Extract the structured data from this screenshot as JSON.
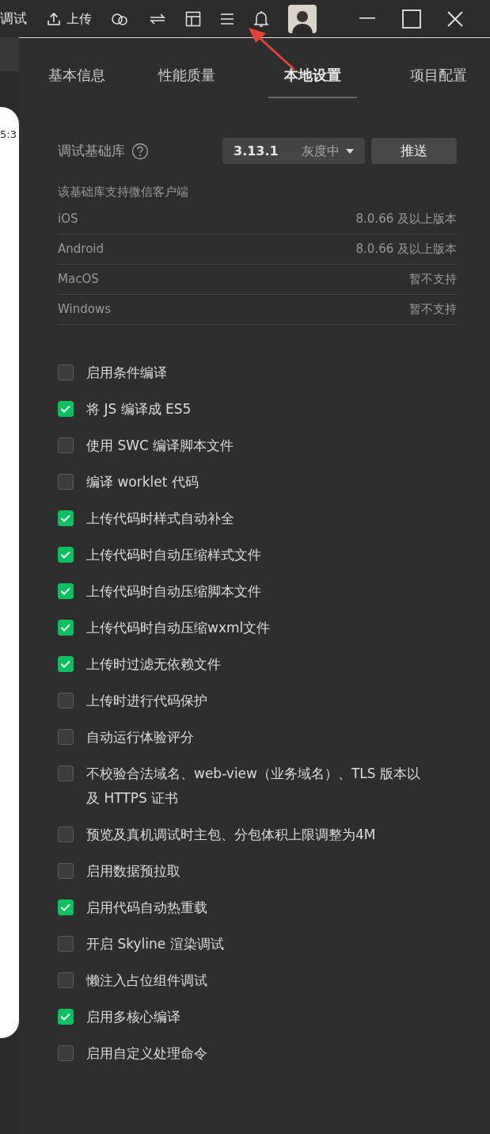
{
  "toolbar": {
    "debug_label": "调试",
    "upload_label": "上传"
  },
  "simulator": {
    "time": "5:3"
  },
  "tabs": [
    {
      "label": "基本信息",
      "selected": false
    },
    {
      "label": "性能质量",
      "selected": false
    },
    {
      "label": "本地设置",
      "selected": true
    },
    {
      "label": "项目配置",
      "selected": false
    }
  ],
  "base_library": {
    "label": "调试基础库",
    "version": "3.13.1",
    "channel": "灰度中",
    "push_button": "推送"
  },
  "support": {
    "heading": "该基础库支持微信客户端",
    "rows": [
      {
        "platform": "iOS",
        "requirement": "8.0.66 及以上版本"
      },
      {
        "platform": "Android",
        "requirement": "8.0.66 及以上版本"
      },
      {
        "platform": "MacOS",
        "requirement": "暂不支持"
      },
      {
        "platform": "Windows",
        "requirement": "暂不支持"
      }
    ]
  },
  "options": [
    {
      "label": "启用条件编译",
      "checked": false
    },
    {
      "label": "将 JS 编译成 ES5",
      "checked": true
    },
    {
      "label": "使用 SWC 编译脚本文件",
      "checked": false
    },
    {
      "label": "编译 worklet 代码",
      "checked": false
    },
    {
      "label": "上传代码时样式自动补全",
      "checked": true
    },
    {
      "label": "上传代码时自动压缩样式文件",
      "checked": true
    },
    {
      "label": "上传代码时自动压缩脚本文件",
      "checked": true
    },
    {
      "label": "上传代码时自动压缩wxml文件",
      "checked": true
    },
    {
      "label": "上传时过滤无依赖文件",
      "checked": true
    },
    {
      "label": "上传时进行代码保护",
      "checked": false
    },
    {
      "label": "自动运行体验评分",
      "checked": false
    },
    {
      "label": "不校验合法域名、web-view（业务域名）、TLS 版本以及 HTTPS 证书",
      "checked": false
    },
    {
      "label": "预览及真机调试时主包、分包体积上限调整为4M",
      "checked": false
    },
    {
      "label": "启用数据预拉取",
      "checked": false
    },
    {
      "label": "启用代码自动热重载",
      "checked": true
    },
    {
      "label": "开启 Skyline 渲染调试",
      "checked": false
    },
    {
      "label": "懒注入占位组件调试",
      "checked": false
    },
    {
      "label": "启用多核心编译",
      "checked": true
    },
    {
      "label": "启用自定义处理命令",
      "checked": false
    }
  ]
}
